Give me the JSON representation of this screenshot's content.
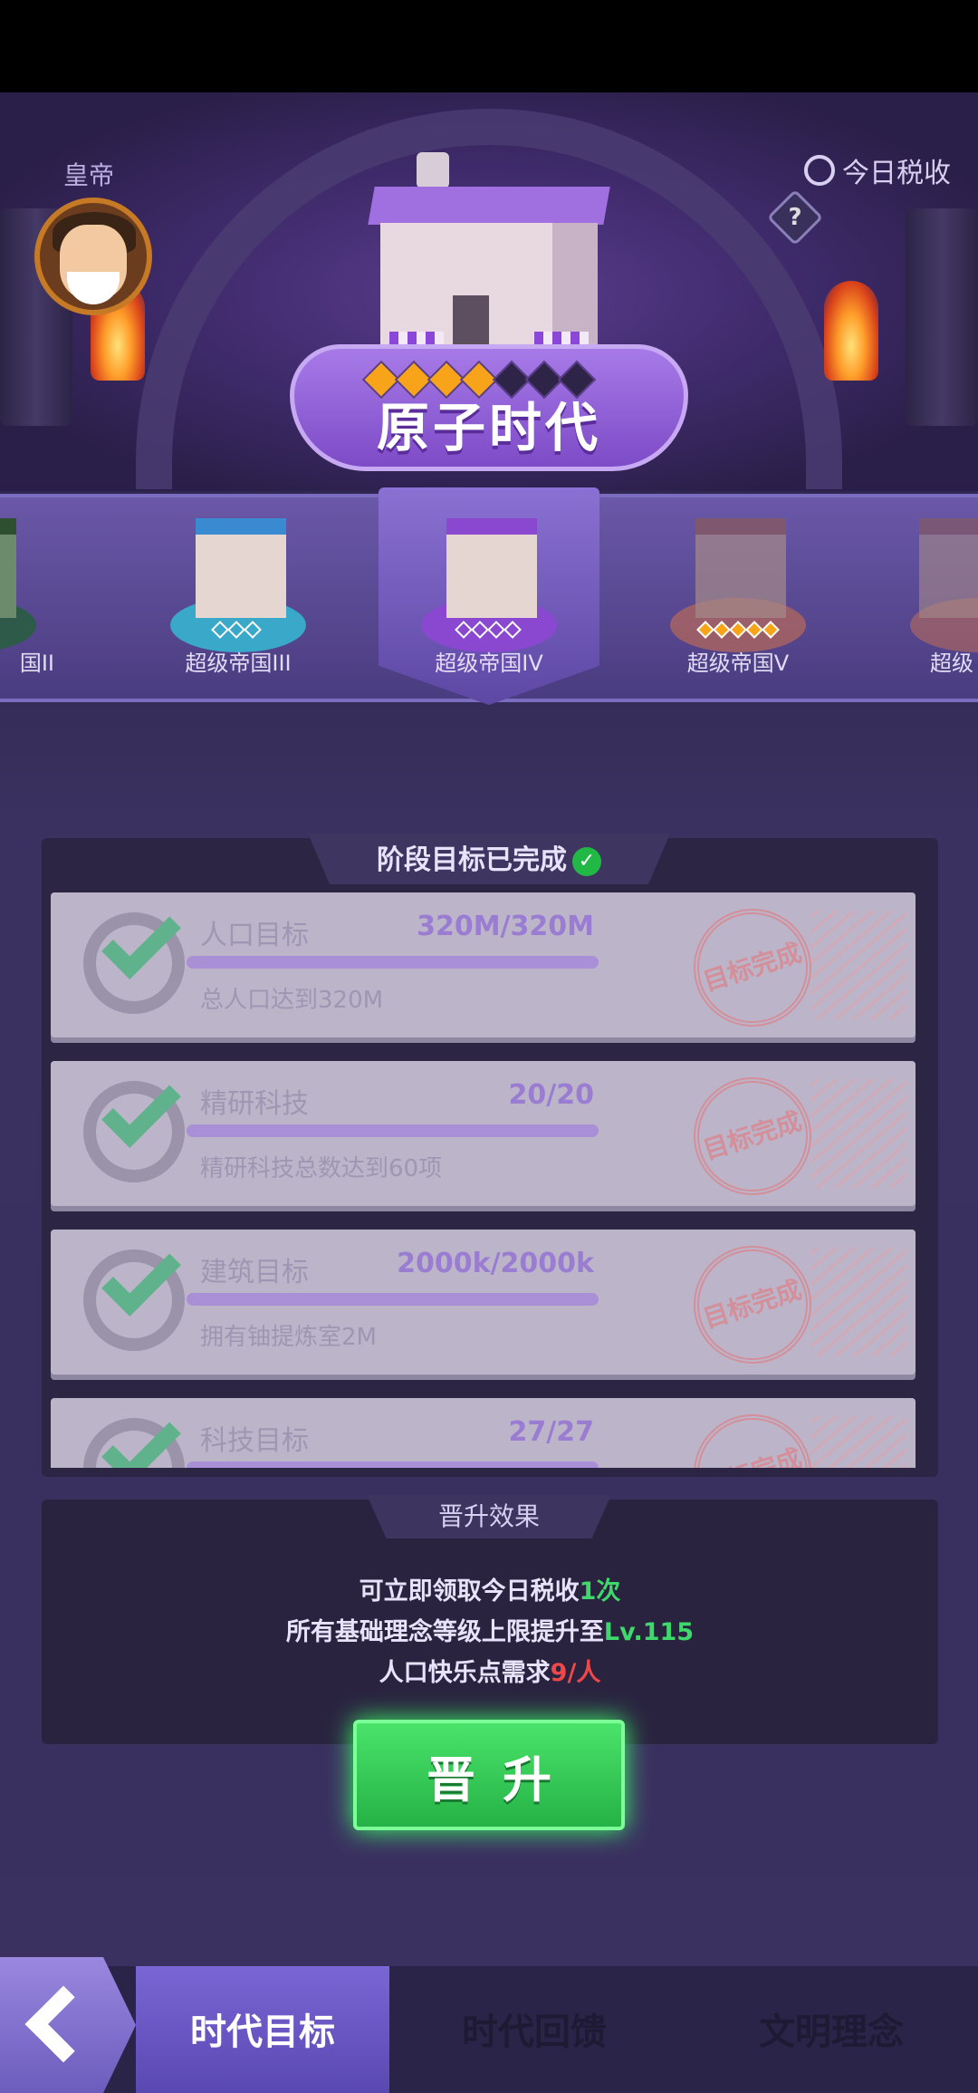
{
  "header": {
    "emperor_label": "皇帝",
    "tax_label": "今日税收",
    "help_symbol": "?",
    "era_title": "原子时代",
    "stars_filled": 4,
    "stars_total": 7
  },
  "eras": [
    {
      "label": "国II"
    },
    {
      "label": "超级帝国III"
    },
    {
      "label": "超级帝国IV",
      "selected": true
    },
    {
      "label": "超级帝国V"
    },
    {
      "label": "超级"
    }
  ],
  "goals": {
    "title": "阶段目标已完成",
    "items": [
      {
        "name": "人口目标",
        "progress": "320M/320M",
        "desc": "总人口达到320M",
        "stamp": "目标完成"
      },
      {
        "name": "精研科技",
        "progress": "20/20",
        "desc": "精研科技总数达到60项",
        "stamp": "目标完成"
      },
      {
        "name": "建筑目标",
        "progress": "2000k/2000k",
        "desc": "拥有铀提炼室2M",
        "stamp": "目标完成"
      },
      {
        "name": "科技目标",
        "progress": "27/27",
        "desc": "",
        "stamp": "目标完成"
      }
    ]
  },
  "effects": {
    "title": "晋升效果",
    "line1_prefix": "可立即领取今日税收",
    "line1_value": "1次",
    "line2_prefix": "所有基础理念等级上限提升至",
    "line2_value": "Lv.115",
    "line3_prefix": "人口快乐点需求",
    "line3_value": "9/人"
  },
  "promote_button": "晋升",
  "tabs": [
    "时代目标",
    "时代回馈",
    "文明理念"
  ],
  "colors": {
    "accent": "#7a66d4",
    "success": "#3fd86a",
    "warning": "#f04848"
  }
}
